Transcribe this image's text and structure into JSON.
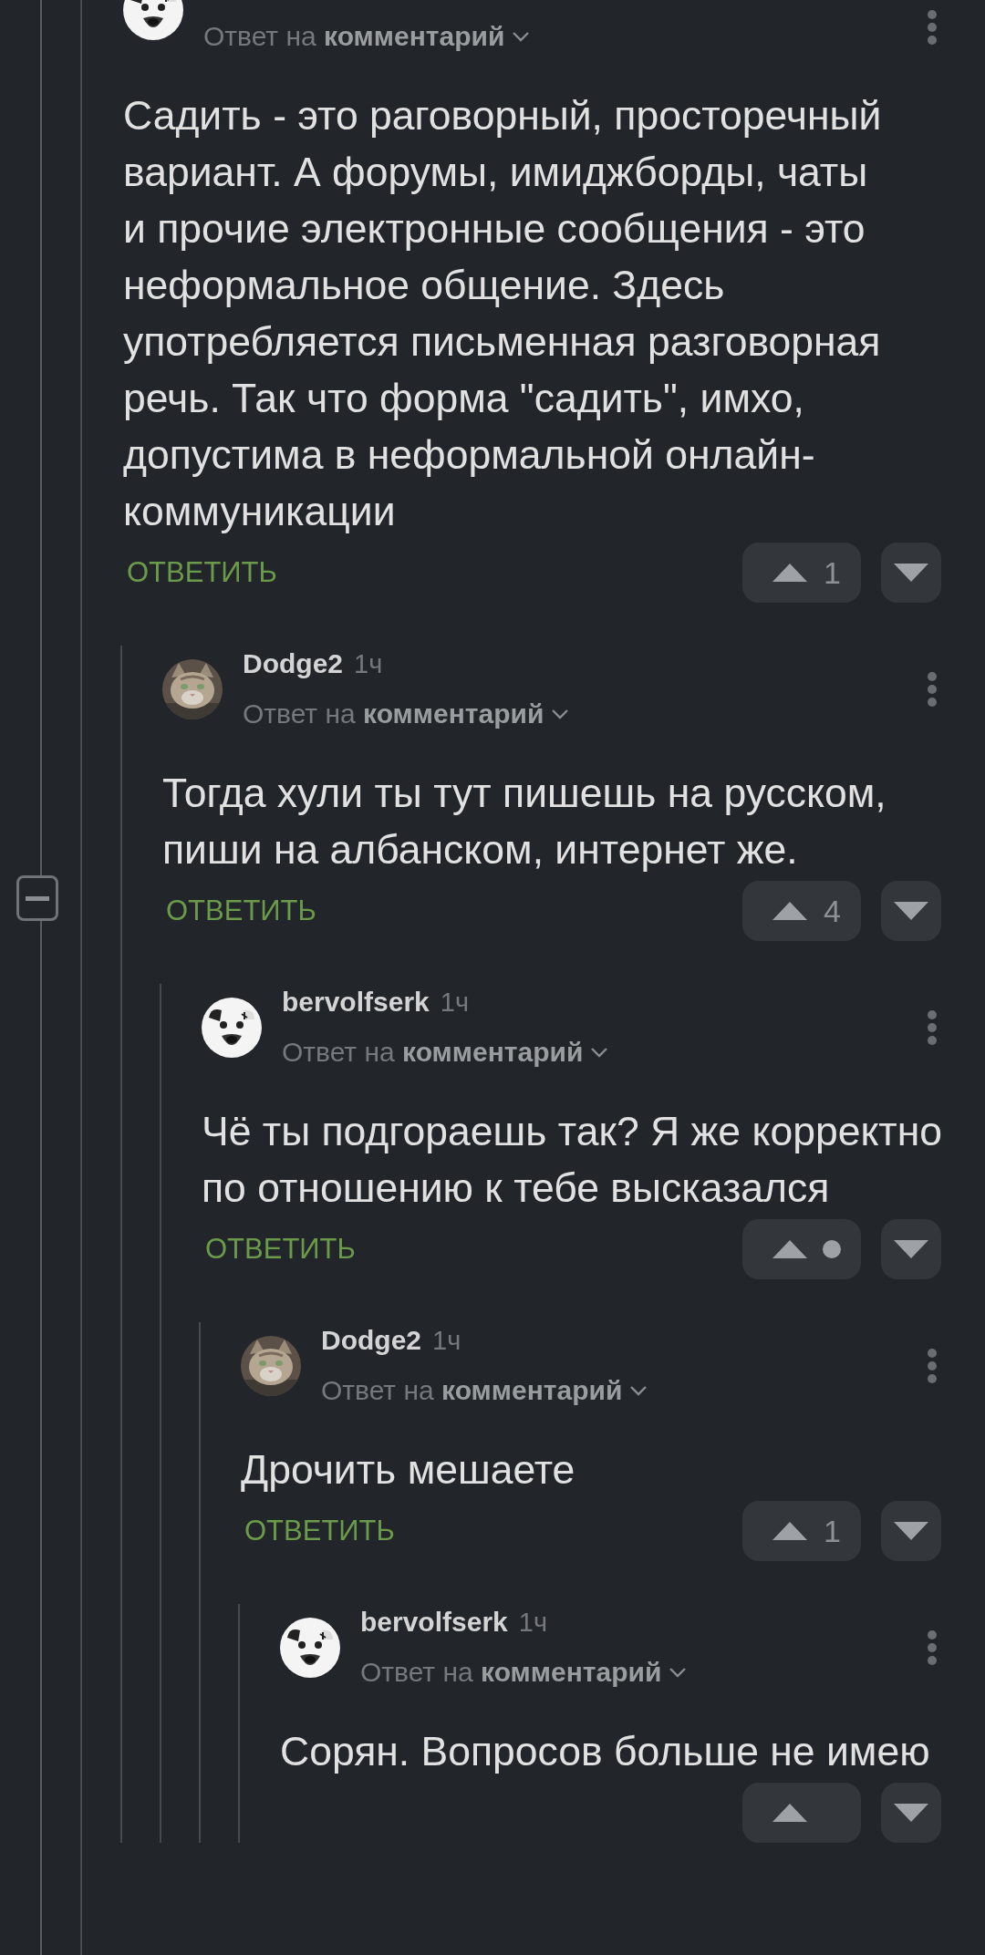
{
  "comments": [
    {
      "avatar": {
        "kind": "dog"
      },
      "reply_to": {
        "prefix": "Ответ на",
        "target": "комментарий"
      },
      "text": "Садить - это раговорный, просторечный вариант. А форумы, имиджборды, чаты и прочие электронные сообщения - это неформальное общение. Здесь употребляется письменная разговорная речь. Так что форма \"садить\", имхо, допустима в неформальной онлайн-коммуникации",
      "reply": "ОТВЕТИТЬ",
      "rating": "1",
      "rating_hidden": false,
      "children": [
        {
          "author": "Dodge2",
          "time": "1ч",
          "reply_to": {
            "prefix": "Ответ на",
            "target": "комментарий"
          },
          "text": "Тогда хули ты тут пишешь на русском, пиши на албанском, интернет же.",
          "reply": "ОТВЕТИТЬ",
          "rating": "4",
          "rating_hidden": false,
          "children": [
            {
              "avatar": {
                "kind": "dog"
              },
              "author": "bervolfserk",
              "time": "1ч",
              "reply_to": {
                "prefix": "Ответ на",
                "target": "комментарий"
              },
              "text": "Чё ты подгораешь так? Я же корректно по отношению к тебе высказался",
              "reply": "ОТВЕТИТЬ",
              "rating_hidden": true,
              "children": [
                {
                  "author": "Dodge2",
                  "time": "1ч",
                  "reply_to": {
                    "prefix": "Ответ на",
                    "target": "комментарий"
                  },
                  "text": "Дрочить мешаете",
                  "reply": "ОТВЕТИТЬ",
                  "rating": "1",
                  "rating_hidden": false,
                  "children": [
                    {
                      "avatar": {
                        "kind": "dog"
                      },
                      "author": "bervolfserk",
                      "time": "1ч",
                      "reply_to": {
                        "prefix": "Ответ на",
                        "target": "комментарий"
                      },
                      "text": "Сорян. Вопросов больше не имею",
                      "rating_hidden": false
                    }
                  ]
                }
              ]
            }
          ]
        }
      ]
    }
  ]
}
